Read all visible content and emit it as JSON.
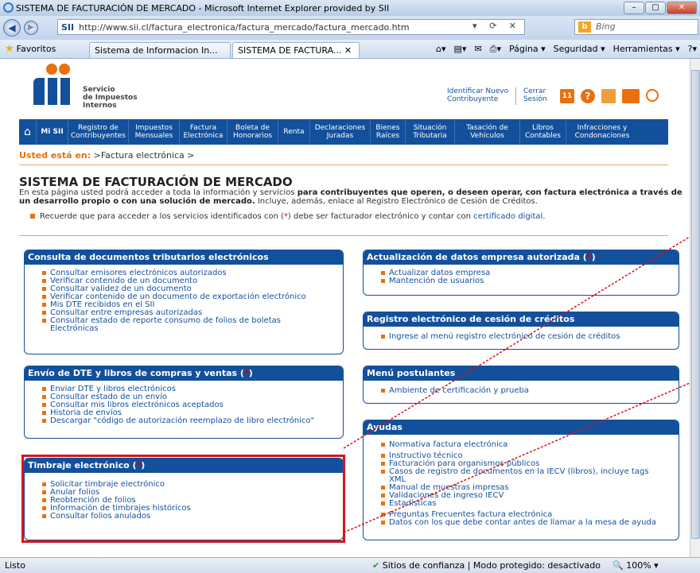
{
  "browser": {
    "title": "SISTEMA DE FACTURACIÓN DE MERCADO - Microsoft Internet Explorer provided by SII",
    "address": "http://www.sii.cl/factura_electronica/factura_mercado/factura_mercado.htm",
    "address_host": "SII",
    "search_placeholder": "Bing",
    "favorites_label": "Favoritos",
    "tabs": [
      {
        "label": "Sistema de Informacion In...",
        "active": false
      },
      {
        "label": "SISTEMA DE FACTURA...",
        "active": true
      }
    ],
    "commands": [
      "Página ▾",
      "Seguridad ▾",
      "Herramientas ▾",
      "?▾"
    ],
    "status": "Listo",
    "zone": "Sitios de confianza | Modo protegido: desactivado",
    "zoom": "100%"
  },
  "site": {
    "brand": [
      "Servicio",
      "de Impuestos",
      "Internos"
    ],
    "toplinks": [
      {
        "line1": "Identificar Nuevo",
        "line2": "Contribuyente"
      },
      {
        "line1": "Cerrar",
        "line2": "Sesión"
      }
    ],
    "calendar_day": "11",
    "nav": [
      {
        "line1": "Mi SII",
        "line2": ""
      },
      {
        "line1": "Registro de",
        "line2": "Contribuyentes"
      },
      {
        "line1": "Impuestos",
        "line2": "Mensuales"
      },
      {
        "line1": "Factura",
        "line2": "Electrónica"
      },
      {
        "line1": "Boleta de",
        "line2": "Honorarios"
      },
      {
        "line1": "Renta",
        "line2": ""
      },
      {
        "line1": "Declaraciones",
        "line2": "Juradas"
      },
      {
        "line1": "Bienes",
        "line2": "Raíces"
      },
      {
        "line1": "Situación",
        "line2": "Tributaria"
      },
      {
        "line1": "Tasación de",
        "line2": "Vehículos"
      },
      {
        "line1": "Libros",
        "line2": "Contables"
      },
      {
        "line1": "Infracciones y",
        "line2": "Condonaciones"
      }
    ]
  },
  "page": {
    "breadcrumb_label": "Usted está en:",
    "breadcrumb_path": " >Factura electrónica >",
    "title": "SISTEMA DE FACTURACIÓN DE MERCADO",
    "desc_1": "En esta página usted podrá acceder a toda la información y servicios ",
    "desc_2": "para contribuyentes que operen, o deseen operar, con factura electrónica a través de un desarrollo propio o con una solución de mercado.",
    "desc_3": " Incluye, además, enlace al Registro Electrónico de Cesión de Créditos.",
    "note_1": "Recuerde que para acceder a los servicios identificados con (",
    "note_mark": "*",
    "note_2": ") debe ser facturador electrónico y contar con ",
    "note_link": "certificado digital",
    "note_3": "."
  },
  "boxes": {
    "consulta": {
      "title": "Consulta de documentos tributarios electrónicos",
      "items": [
        "Consultar emisores electrónicos autorizados",
        "Verificar contenido de un documento",
        "Consultar validez de un documento",
        "Verificar contenido de un documento de exportación electrónico",
        "Mis DTE recibidos en el SII",
        "Consultar entre empresas autorizadas",
        "Consultar estado de reporte consumo de folios de boletas Electrónicas"
      ]
    },
    "envio": {
      "title": "Envío de DTE y libros de compras y ventas (",
      "mark": "*",
      "close": ")",
      "items": [
        "Enviar DTE y libros electrónicos",
        "Consultar estado de un envío",
        "Consultar mis libros electrónicos aceptados",
        "Historia de envíos",
        "Descargar \"código de autorización reemplazo de libro electrónico\""
      ]
    },
    "timbraje": {
      "title": "Timbraje electrónico (",
      "mark": "*",
      "close": ")",
      "items": [
        "Solicitar timbraje electrónico",
        "Anular folios",
        "Reobtención de folios",
        "Información de timbrajes históricos",
        "Consultar folios anulados"
      ]
    },
    "actualizacion": {
      "title": "Actualización de datos empresa autorizada (",
      "mark": "*",
      "close": ")",
      "items": [
        "Actualizar datos empresa",
        "Mantención de usuarios"
      ]
    },
    "registro": {
      "title": "Registro electrónico de cesión de créditos",
      "items": [
        "Ingrese al menú registro electrónico de cesión de créditos"
      ]
    },
    "postulantes": {
      "title": "Menú postulantes",
      "items": [
        "Ambiente de certificación y prueba"
      ]
    },
    "ayudas": {
      "title": "Ayudas",
      "items": [
        "Normativa factura electrónica",
        "Instructivo técnico",
        "Facturación para organismos públicos",
        "Casos de registro de documentos en la IECV (libros), incluye tags XML",
        "Manual de muestras impresas",
        "Validaciones de ingreso IECV",
        "Estadísticas",
        "Preguntas Frecuentes factura electrónica",
        "Datos con los que debe contar antes de llamar a la mesa de ayuda"
      ]
    }
  },
  "colors": {
    "sii_blue": "#13509b",
    "sii_orange": "#e8700f",
    "highlight_red": "#d7141f"
  }
}
